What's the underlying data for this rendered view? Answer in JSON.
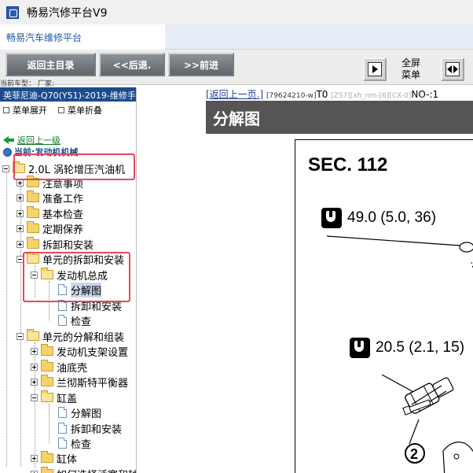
{
  "window": {
    "title": "畅易汽修平台V9"
  },
  "tab": {
    "label": "畅易汽车维修平台"
  },
  "toolbar": {
    "home": "返回主目录",
    "back": "<<后退.",
    "forward": ">>前进",
    "fullscreen_line1": "全屏",
    "fullscreen_line2": "菜单"
  },
  "vehicle_line": "当前车型：  厂家:",
  "sidebar": {
    "model": "英菲尼迪-Q70(Y51)-2019-维修手册",
    "expand": "菜单展开",
    "collapse": "菜单折叠",
    "back_up": "返回上一级",
    "current": "当前:发动机机械",
    "tree": [
      {
        "label": "2.0L 涡轮增压汽油机"
      },
      {
        "label": "注意事项"
      },
      {
        "label": "准备工作"
      },
      {
        "label": "基本检查"
      },
      {
        "label": "定期保养"
      },
      {
        "label": "拆卸和安装"
      },
      {
        "label": "单元的拆卸和安装"
      },
      {
        "label": "发动机总成"
      },
      {
        "label": "分解图"
      },
      {
        "label": "拆卸和安装"
      },
      {
        "label": "检查"
      },
      {
        "label": "单元的分解和组装"
      },
      {
        "label": "发动机支架设置"
      },
      {
        "label": "油底壳"
      },
      {
        "label": "兰彻斯特平衡器"
      },
      {
        "label": "缸盖"
      },
      {
        "label": "分解图"
      },
      {
        "label": "拆卸和安装"
      },
      {
        "label": "检查"
      },
      {
        "label": "缸体"
      },
      {
        "label": "如何选择活塞和轴"
      }
    ]
  },
  "content": {
    "back_link": "[返回上一页.]",
    "code": "[79624210-w]",
    "t0": "T0",
    "gray_code": "[ZS7][xh_nm-[6][CX-0]",
    "no": "NO-:1",
    "heading": "分解图",
    "sec": "SEC. 112",
    "torque1": "49.0 (5.0, 36)",
    "torque2": "20.5 (2.1, 15)",
    "callout": "2"
  }
}
